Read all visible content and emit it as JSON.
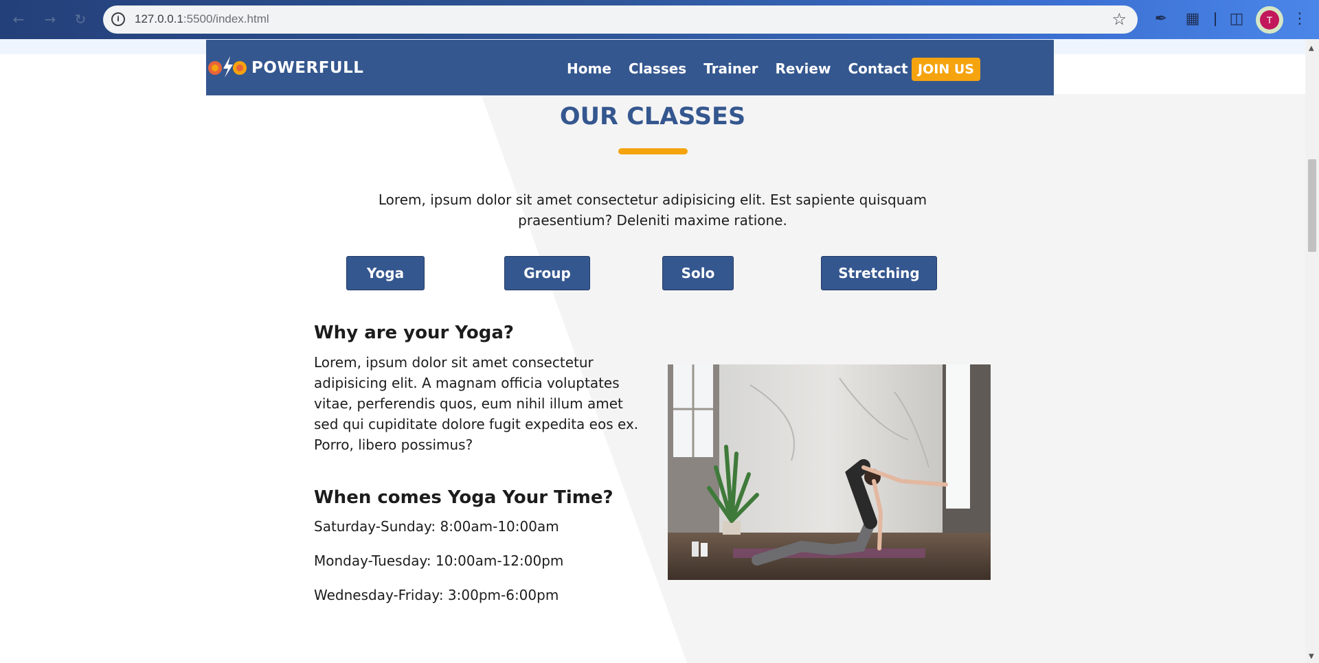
{
  "browser": {
    "url_host": "127.0.0.1",
    "url_path": ":5500/index.html",
    "avatar_initial": "T"
  },
  "header": {
    "brand": "POWERFULL",
    "nav": [
      "Home",
      "Classes",
      "Trainer",
      "Review",
      "Contact"
    ],
    "join_label": "JOIN US"
  },
  "section": {
    "title": "OUR CLASSES",
    "intro": "Lorem, ipsum dolor sit amet consectetur adipisicing elit. Est sapiente quisquam praesentium? Deleniti maxime ratione.",
    "tabs": [
      "Yoga",
      "Group",
      "Solo",
      "Stretching"
    ]
  },
  "content": {
    "why_heading": "Why are your Yoga?",
    "why_text": "Lorem, ipsum dolor sit amet consectetur adipisicing elit. A magnam officia voluptates vitae, perferendis quos, eum nihil illum amet sed qui cupiditate dolore fugit expedita eos ex. Porro, libero possimus?",
    "when_heading": "When comes Yoga Your Time?",
    "schedule": [
      "Saturday-Sunday: 8:00am-10:00am",
      "Monday-Tuesday: 10:00am-12:00pm",
      "Wednesday-Friday: 3:00pm-6:00pm"
    ]
  },
  "colors": {
    "primary": "#35578f",
    "accent": "#f5a30f",
    "background_diagonal": "#f4f4f4"
  },
  "icons": [
    "back-icon",
    "forward-icon",
    "reload-icon",
    "info-icon",
    "star-icon",
    "eyedropper-icon",
    "extensions-icon",
    "side-panel-icon",
    "menu-icon"
  ]
}
